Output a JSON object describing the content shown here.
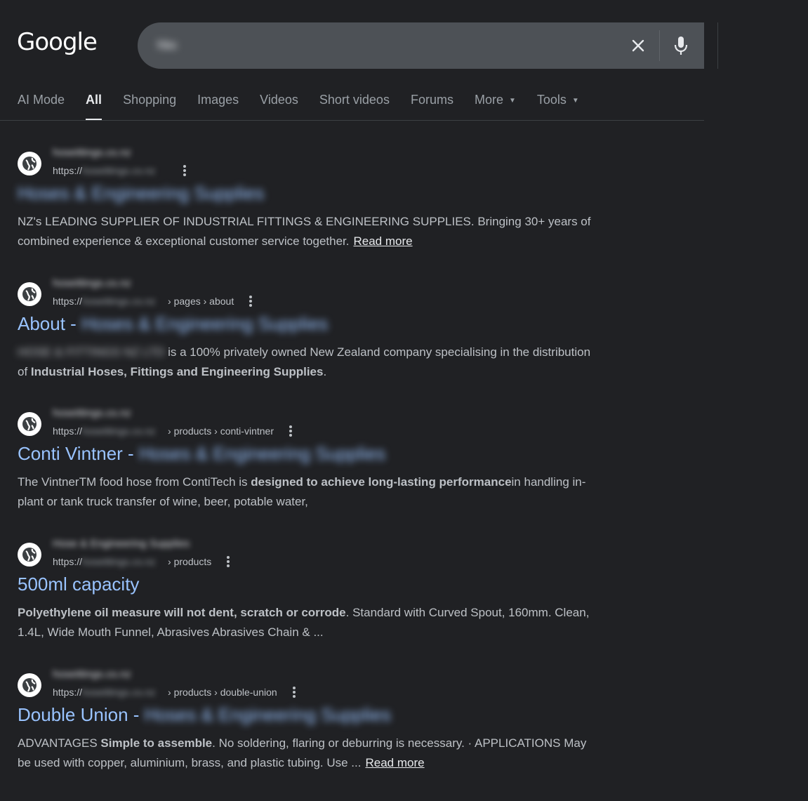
{
  "header": {
    "logo": "Google",
    "search_query": "hbc"
  },
  "tabs": [
    {
      "label": "AI Mode"
    },
    {
      "label": "All"
    },
    {
      "label": "Shopping"
    },
    {
      "label": "Images"
    },
    {
      "label": "Videos"
    },
    {
      "label": "Short videos"
    },
    {
      "label": "Forums"
    },
    {
      "label": "More"
    },
    {
      "label": "Tools"
    }
  ],
  "results": [
    {
      "site_name": "hoseittings.co.nz",
      "cite_prefix": "https://",
      "cite_domain": "hoseittings.co.nz",
      "cite_path": "",
      "title_main": "",
      "title_blurred": "Hoses & Engineering Supplies",
      "snippet_1": "NZ's LEADING SUPPLIER OF INDUSTRIAL FITTINGS & ENGINEERING SUPPLIES. Bringing 30+ years of combined experience & exceptional customer service together.",
      "read_more": "Read more"
    },
    {
      "site_name": "hoseittings.co.nz",
      "cite_prefix": "https://",
      "cite_domain": "hoseittings.co.nz",
      "cite_path": "› pages › about",
      "title_main": "About - ",
      "title_blurred": "Hoses & Engineering Supplies",
      "snippet_blurred": "HOSE & FITTINGS NZ LTD",
      "snippet_1": " is a 100% privately owned New Zealand company specialising in the distribution of ",
      "snippet_bold": "Industrial Hoses, Fittings and Engineering Supplies",
      "snippet_2": "."
    },
    {
      "site_name": "hoseittings.co.nz",
      "cite_prefix": "https://",
      "cite_domain": "hoseittings.co.nz",
      "cite_path": "› products › conti-vintner",
      "title_main": "Conti Vintner - ",
      "title_blurred": "Hoses & Engineering Supplies",
      "snippet_1": "The VintnerTM food hose from ContiTech is ",
      "snippet_bold": "designed to achieve long-lasting performance",
      "snippet_2": "in handling in-plant or tank truck transfer of wine, beer, potable water,"
    },
    {
      "site_name": "Hose & Engineering Supplies",
      "cite_prefix": "https://",
      "cite_domain": "hoseittings.co.nz",
      "cite_path": "› products",
      "title_main": "500ml capacity",
      "snippet_bold": "Polyethylene oil measure will not dent, scratch or corrode",
      "snippet_2": ". Standard with Curved Spout, 160mm. Clean, 1.4L, Wide Mouth Funnel, Abrasives Abrasives Chain & ..."
    },
    {
      "site_name": "hoseittings.co.nz",
      "cite_prefix": "https://",
      "cite_domain": "hoseittings.co.nz",
      "cite_path": "› products › double-union",
      "title_main": "Double Union - ",
      "title_blurred": "Hoses & Engineering Supplies",
      "snippet_1": "ADVANTAGES ",
      "snippet_bold": "Simple to assemble",
      "snippet_2": ". No soldering, flaring or deburring is necessary. · APPLICATIONS May be used with copper, aluminium, brass, and plastic tubing. Use ...",
      "read_more": "Read more"
    }
  ]
}
